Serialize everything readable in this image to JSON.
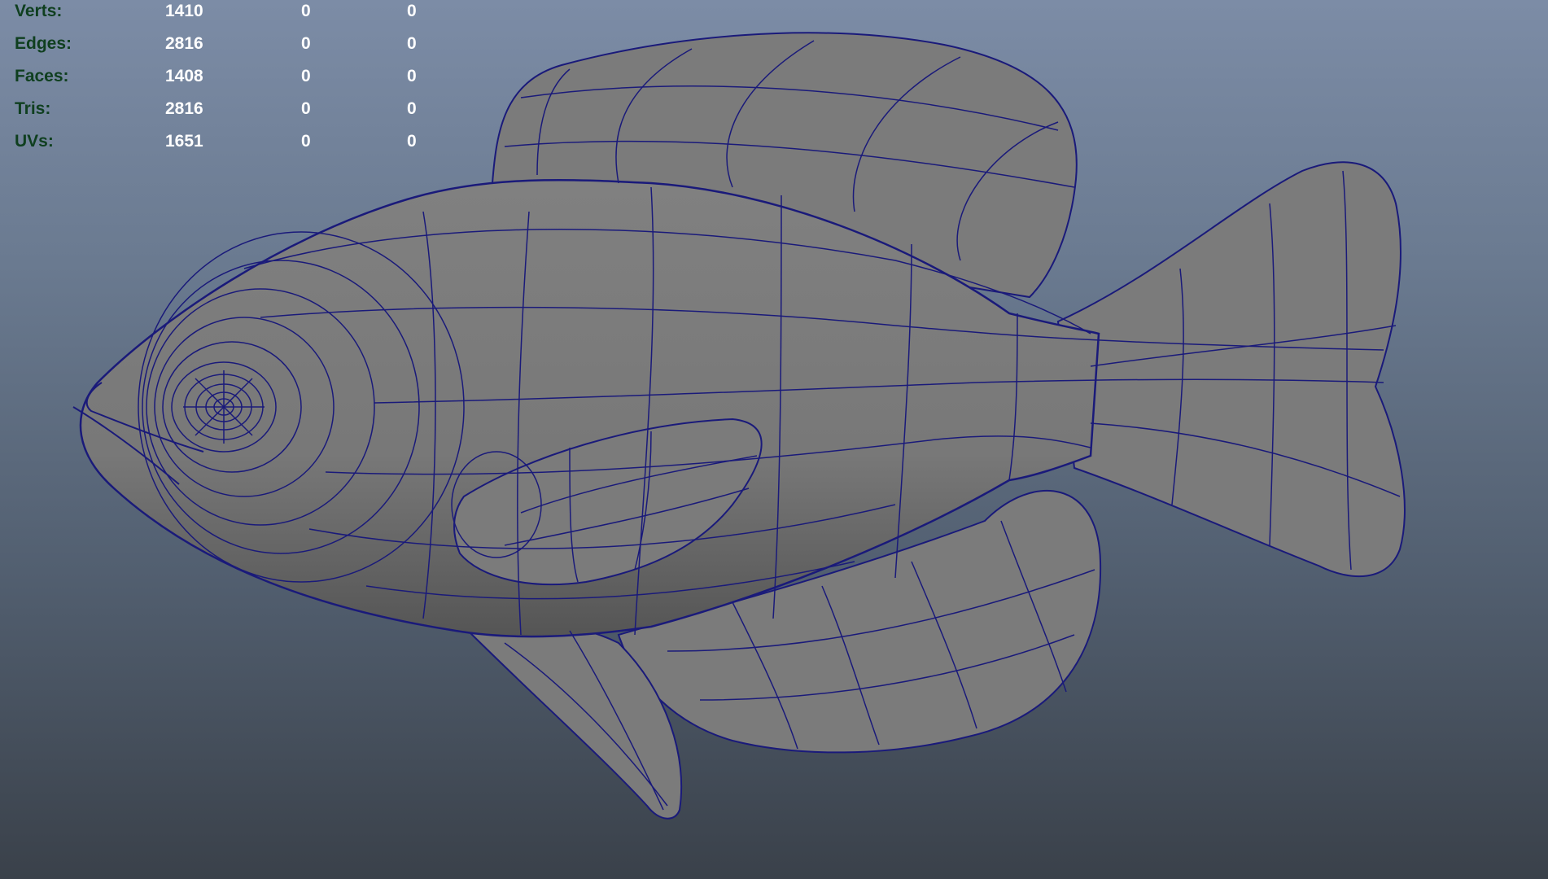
{
  "hud": {
    "rows": [
      {
        "label": "Verts:",
        "values": [
          "1410",
          "0",
          "0"
        ]
      },
      {
        "label": "Edges:",
        "values": [
          "2816",
          "0",
          "0"
        ]
      },
      {
        "label": "Faces:",
        "values": [
          "1408",
          "0",
          "0"
        ]
      },
      {
        "label": "Tris:",
        "values": [
          "2816",
          "0",
          "0"
        ]
      },
      {
        "label": "UVs:",
        "values": [
          "1651",
          "0",
          "0"
        ]
      }
    ]
  },
  "colors": {
    "wire": "#1a1a7a",
    "mesh": "#7b7b7b",
    "label": "#0f3f1f",
    "value": "#ffffff"
  }
}
